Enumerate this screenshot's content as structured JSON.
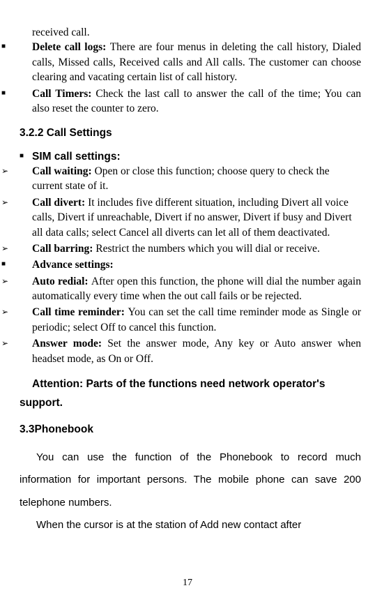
{
  "intro_text": "received call.",
  "delete_logs_label": "Delete call logs: ",
  "delete_logs_text": "There are four menus in deleting the call history, Dialed calls, Missed calls, Received calls and All calls. The customer can choose clearing and vacating certain list of call history.",
  "call_timers_label": "Call Timers: ",
  "call_timers_text": "Check the last call to answer the call of the time; You can also reset the counter to zero.",
  "heading_322": "3.2.2 Call Settings",
  "sim_heading": "SIM call settings:",
  "call_waiting_label": "Call waiting: ",
  "call_waiting_text": "Open or close this function; choose query to check the current state of it.",
  "call_divert_label": "Call divert: ",
  "call_divert_text": "It includes five different situation, including Divert all voice calls, Divert if unreachable, Divert if no answer, Divert if busy and Divert all data calls; select Cancel all diverts can let all of them deactivated.",
  "call_barring_label": "Call barring: ",
  "call_barring_text": "Restrict the numbers which you will dial or receive.",
  "advance_label": "Advance settings:",
  "auto_redial_label": "Auto redial: ",
  "auto_redial_text": "After open this function, the phone will dial the number again automatically every time when the out call fails or be rejected.",
  "call_reminder_label": "Call time reminder: ",
  "call_reminder_text": "You can set the call time reminder mode as Single or periodic; select Off to cancel this function.",
  "answer_mode_label": "Answer mode: ",
  "answer_mode_text": "Set the answer mode, Any key or Auto answer when headset mode, as On or Off.",
  "attention_text": "Attention: Parts of the functions need network operator's",
  "support_text": "support.",
  "phonebook_heading": "3.3Phonebook",
  "phonebook_para1": "You can use the function of the Phonebook to record much information for important persons. The mobile phone can save 200 telephone numbers.",
  "phonebook_para2": "When the cursor is at the station of Add new contact after",
  "page_number": "17"
}
